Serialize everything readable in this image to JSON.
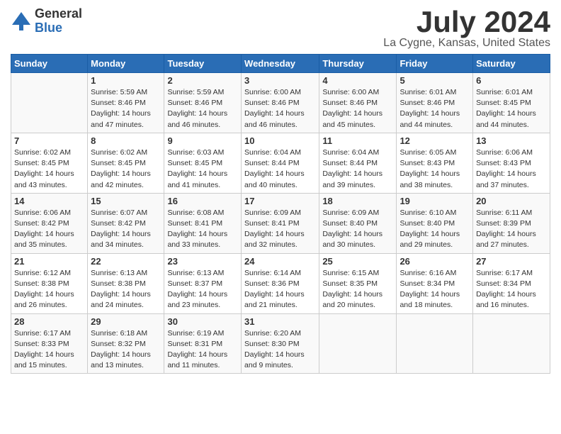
{
  "header": {
    "logo_general": "General",
    "logo_blue": "Blue",
    "month": "July 2024",
    "location": "La Cygne, Kansas, United States"
  },
  "weekdays": [
    "Sunday",
    "Monday",
    "Tuesday",
    "Wednesday",
    "Thursday",
    "Friday",
    "Saturday"
  ],
  "weeks": [
    [
      {
        "day": "",
        "info": ""
      },
      {
        "day": "1",
        "info": "Sunrise: 5:59 AM\nSunset: 8:46 PM\nDaylight: 14 hours\nand 47 minutes."
      },
      {
        "day": "2",
        "info": "Sunrise: 5:59 AM\nSunset: 8:46 PM\nDaylight: 14 hours\nand 46 minutes."
      },
      {
        "day": "3",
        "info": "Sunrise: 6:00 AM\nSunset: 8:46 PM\nDaylight: 14 hours\nand 46 minutes."
      },
      {
        "day": "4",
        "info": "Sunrise: 6:00 AM\nSunset: 8:46 PM\nDaylight: 14 hours\nand 45 minutes."
      },
      {
        "day": "5",
        "info": "Sunrise: 6:01 AM\nSunset: 8:46 PM\nDaylight: 14 hours\nand 44 minutes."
      },
      {
        "day": "6",
        "info": "Sunrise: 6:01 AM\nSunset: 8:45 PM\nDaylight: 14 hours\nand 44 minutes."
      }
    ],
    [
      {
        "day": "7",
        "info": ""
      },
      {
        "day": "8",
        "info": "Sunrise: 6:02 AM\nSunset: 8:45 PM\nDaylight: 14 hours\nand 42 minutes."
      },
      {
        "day": "9",
        "info": "Sunrise: 6:03 AM\nSunset: 8:45 PM\nDaylight: 14 hours\nand 41 minutes."
      },
      {
        "day": "10",
        "info": "Sunrise: 6:04 AM\nSunset: 8:44 PM\nDaylight: 14 hours\nand 40 minutes."
      },
      {
        "day": "11",
        "info": "Sunrise: 6:04 AM\nSunset: 8:44 PM\nDaylight: 14 hours\nand 39 minutes."
      },
      {
        "day": "12",
        "info": "Sunrise: 6:05 AM\nSunset: 8:43 PM\nDaylight: 14 hours\nand 38 minutes."
      },
      {
        "day": "13",
        "info": "Sunrise: 6:06 AM\nSunset: 8:43 PM\nDaylight: 14 hours\nand 37 minutes."
      }
    ],
    [
      {
        "day": "14",
        "info": ""
      },
      {
        "day": "15",
        "info": "Sunrise: 6:07 AM\nSunset: 8:42 PM\nDaylight: 14 hours\nand 34 minutes."
      },
      {
        "day": "16",
        "info": "Sunrise: 6:08 AM\nSunset: 8:41 PM\nDaylight: 14 hours\nand 33 minutes."
      },
      {
        "day": "17",
        "info": "Sunrise: 6:09 AM\nSunset: 8:41 PM\nDaylight: 14 hours\nand 32 minutes."
      },
      {
        "day": "18",
        "info": "Sunrise: 6:09 AM\nSunset: 8:40 PM\nDaylight: 14 hours\nand 30 minutes."
      },
      {
        "day": "19",
        "info": "Sunrise: 6:10 AM\nSunset: 8:40 PM\nDaylight: 14 hours\nand 29 minutes."
      },
      {
        "day": "20",
        "info": "Sunrise: 6:11 AM\nSunset: 8:39 PM\nDaylight: 14 hours\nand 27 minutes."
      }
    ],
    [
      {
        "day": "21",
        "info": ""
      },
      {
        "day": "22",
        "info": "Sunrise: 6:13 AM\nSunset: 8:38 PM\nDaylight: 14 hours\nand 24 minutes."
      },
      {
        "day": "23",
        "info": "Sunrise: 6:13 AM\nSunset: 8:37 PM\nDaylight: 14 hours\nand 23 minutes."
      },
      {
        "day": "24",
        "info": "Sunrise: 6:14 AM\nSunset: 8:36 PM\nDaylight: 14 hours\nand 21 minutes."
      },
      {
        "day": "25",
        "info": "Sunrise: 6:15 AM\nSunset: 8:35 PM\nDaylight: 14 hours\nand 20 minutes."
      },
      {
        "day": "26",
        "info": "Sunrise: 6:16 AM\nSunset: 8:34 PM\nDaylight: 14 hours\nand 18 minutes."
      },
      {
        "day": "27",
        "info": "Sunrise: 6:17 AM\nSunset: 8:34 PM\nDaylight: 14 hours\nand 16 minutes."
      }
    ],
    [
      {
        "day": "28",
        "info": "Sunrise: 6:17 AM\nSunset: 8:33 PM\nDaylight: 14 hours\nand 15 minutes."
      },
      {
        "day": "29",
        "info": "Sunrise: 6:18 AM\nSunset: 8:32 PM\nDaylight: 14 hours\nand 13 minutes."
      },
      {
        "day": "30",
        "info": "Sunrise: 6:19 AM\nSunset: 8:31 PM\nDaylight: 14 hours\nand 11 minutes."
      },
      {
        "day": "31",
        "info": "Sunrise: 6:20 AM\nSunset: 8:30 PM\nDaylight: 14 hours\nand 9 minutes."
      },
      {
        "day": "",
        "info": ""
      },
      {
        "day": "",
        "info": ""
      },
      {
        "day": "",
        "info": ""
      }
    ]
  ],
  "week1_sunday_info": "Sunrise: 6:02 AM\nSunset: 8:45 PM\nDaylight: 14 hours\nand 43 minutes.",
  "week3_sunday_info": "Sunrise: 6:06 AM\nSunset: 8:42 PM\nDaylight: 14 hours\nand 35 minutes.",
  "week4_sunday_info": "Sunrise: 6:12 AM\nSunset: 8:38 PM\nDaylight: 14 hours\nand 26 minutes."
}
